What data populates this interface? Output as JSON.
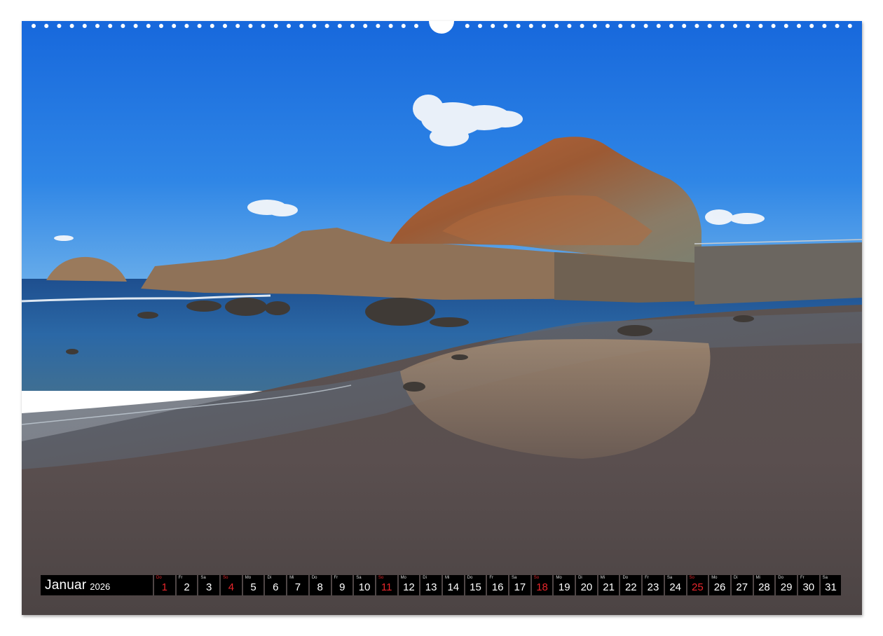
{
  "calendar": {
    "month": "Januar",
    "year": "2026",
    "days": [
      {
        "wd": "Do",
        "num": "1",
        "red": true
      },
      {
        "wd": "Fr",
        "num": "2",
        "red": false
      },
      {
        "wd": "Sa",
        "num": "3",
        "red": false
      },
      {
        "wd": "So",
        "num": "4",
        "red": true
      },
      {
        "wd": "Mo",
        "num": "5",
        "red": false
      },
      {
        "wd": "Di",
        "num": "6",
        "red": false
      },
      {
        "wd": "Mi",
        "num": "7",
        "red": false
      },
      {
        "wd": "Do",
        "num": "8",
        "red": false
      },
      {
        "wd": "Fr",
        "num": "9",
        "red": false
      },
      {
        "wd": "Sa",
        "num": "10",
        "red": false
      },
      {
        "wd": "So",
        "num": "11",
        "red": true
      },
      {
        "wd": "Mo",
        "num": "12",
        "red": false
      },
      {
        "wd": "Di",
        "num": "13",
        "red": false
      },
      {
        "wd": "Mi",
        "num": "14",
        "red": false
      },
      {
        "wd": "Do",
        "num": "15",
        "red": false
      },
      {
        "wd": "Fr",
        "num": "16",
        "red": false
      },
      {
        "wd": "Sa",
        "num": "17",
        "red": false
      },
      {
        "wd": "So",
        "num": "18",
        "red": true
      },
      {
        "wd": "Mo",
        "num": "19",
        "red": false
      },
      {
        "wd": "Di",
        "num": "20",
        "red": false
      },
      {
        "wd": "Mi",
        "num": "21",
        "red": false
      },
      {
        "wd": "Do",
        "num": "22",
        "red": false
      },
      {
        "wd": "Fr",
        "num": "23",
        "red": false
      },
      {
        "wd": "Sa",
        "num": "24",
        "red": false
      },
      {
        "wd": "So",
        "num": "25",
        "red": true
      },
      {
        "wd": "Mo",
        "num": "26",
        "red": false
      },
      {
        "wd": "Di",
        "num": "27",
        "red": false
      },
      {
        "wd": "Mi",
        "num": "28",
        "red": false
      },
      {
        "wd": "Do",
        "num": "29",
        "red": false
      },
      {
        "wd": "Fr",
        "num": "30",
        "red": false
      },
      {
        "wd": "Sa",
        "num": "31",
        "red": false
      }
    ]
  },
  "colors": {
    "cell_background": "#000000",
    "holiday_red": "#e8262b",
    "sky_top": "#1c6fe0",
    "sky_bottom": "#4a9ae8",
    "sand": "#5d5454"
  }
}
